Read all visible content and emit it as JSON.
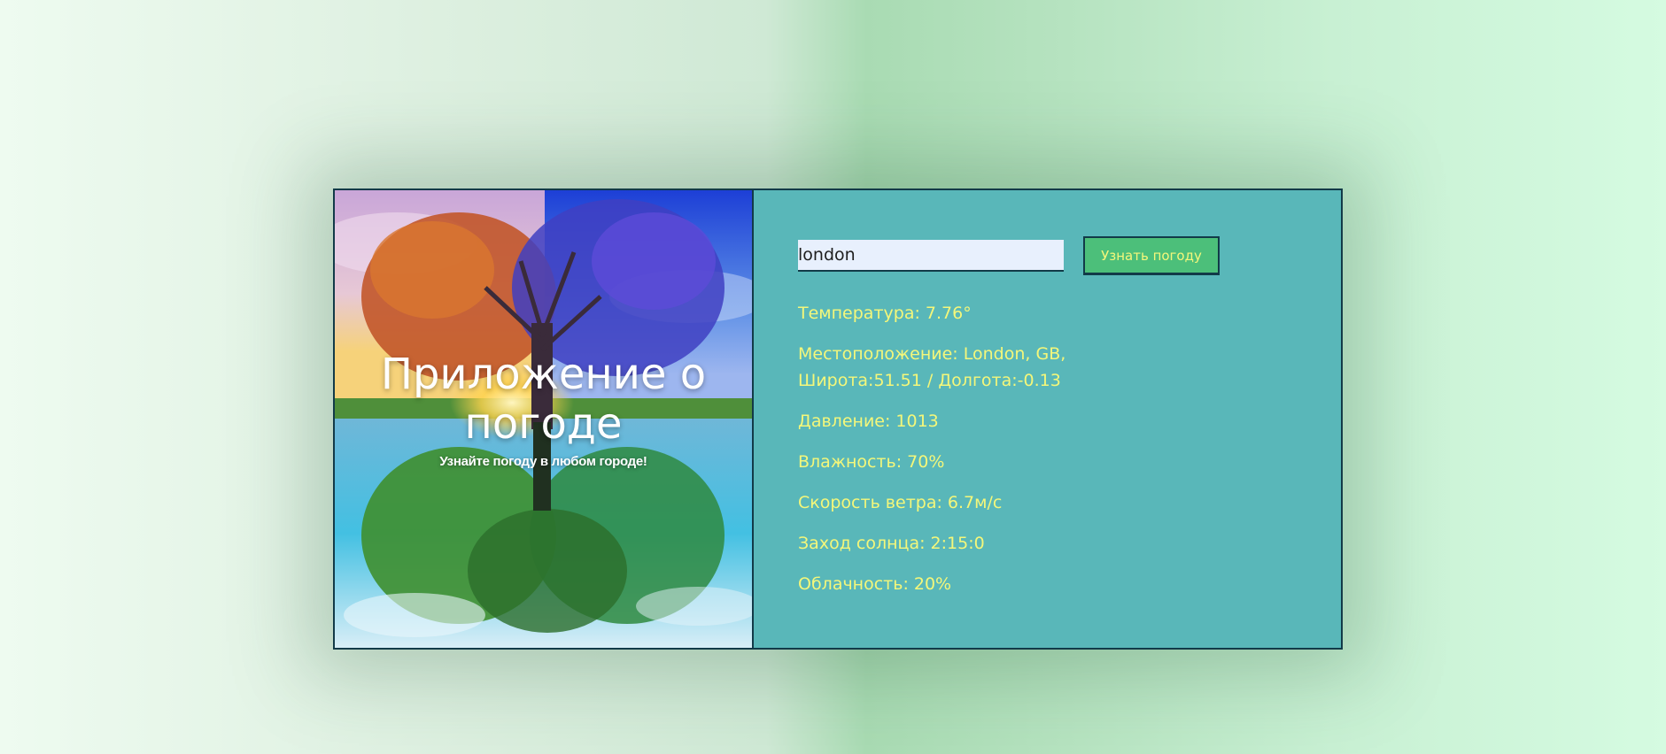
{
  "hero": {
    "title": "Приложение о погоде",
    "subtitle": "Узнайте погоду в любом городе!"
  },
  "search": {
    "value": "london",
    "button_label": "Узнать погоду"
  },
  "weather": {
    "temperature": "Температура: 7.76°",
    "location": "Местоположение: London, GB, Широта:51.51 / Долгота:-0.13",
    "pressure": "Давление: 1013",
    "humidity": "Влажность: 70%",
    "wind_speed": "Скорость ветра: 6.7м/с",
    "sunset": "Заход солнца: 2:15:0",
    "cloudiness": "Облачность: 20%"
  },
  "colors": {
    "panel_bg": "#59b7b9",
    "info_text": "#f4f77a",
    "button_bg": "#4cbf7a",
    "border": "#123a48"
  }
}
